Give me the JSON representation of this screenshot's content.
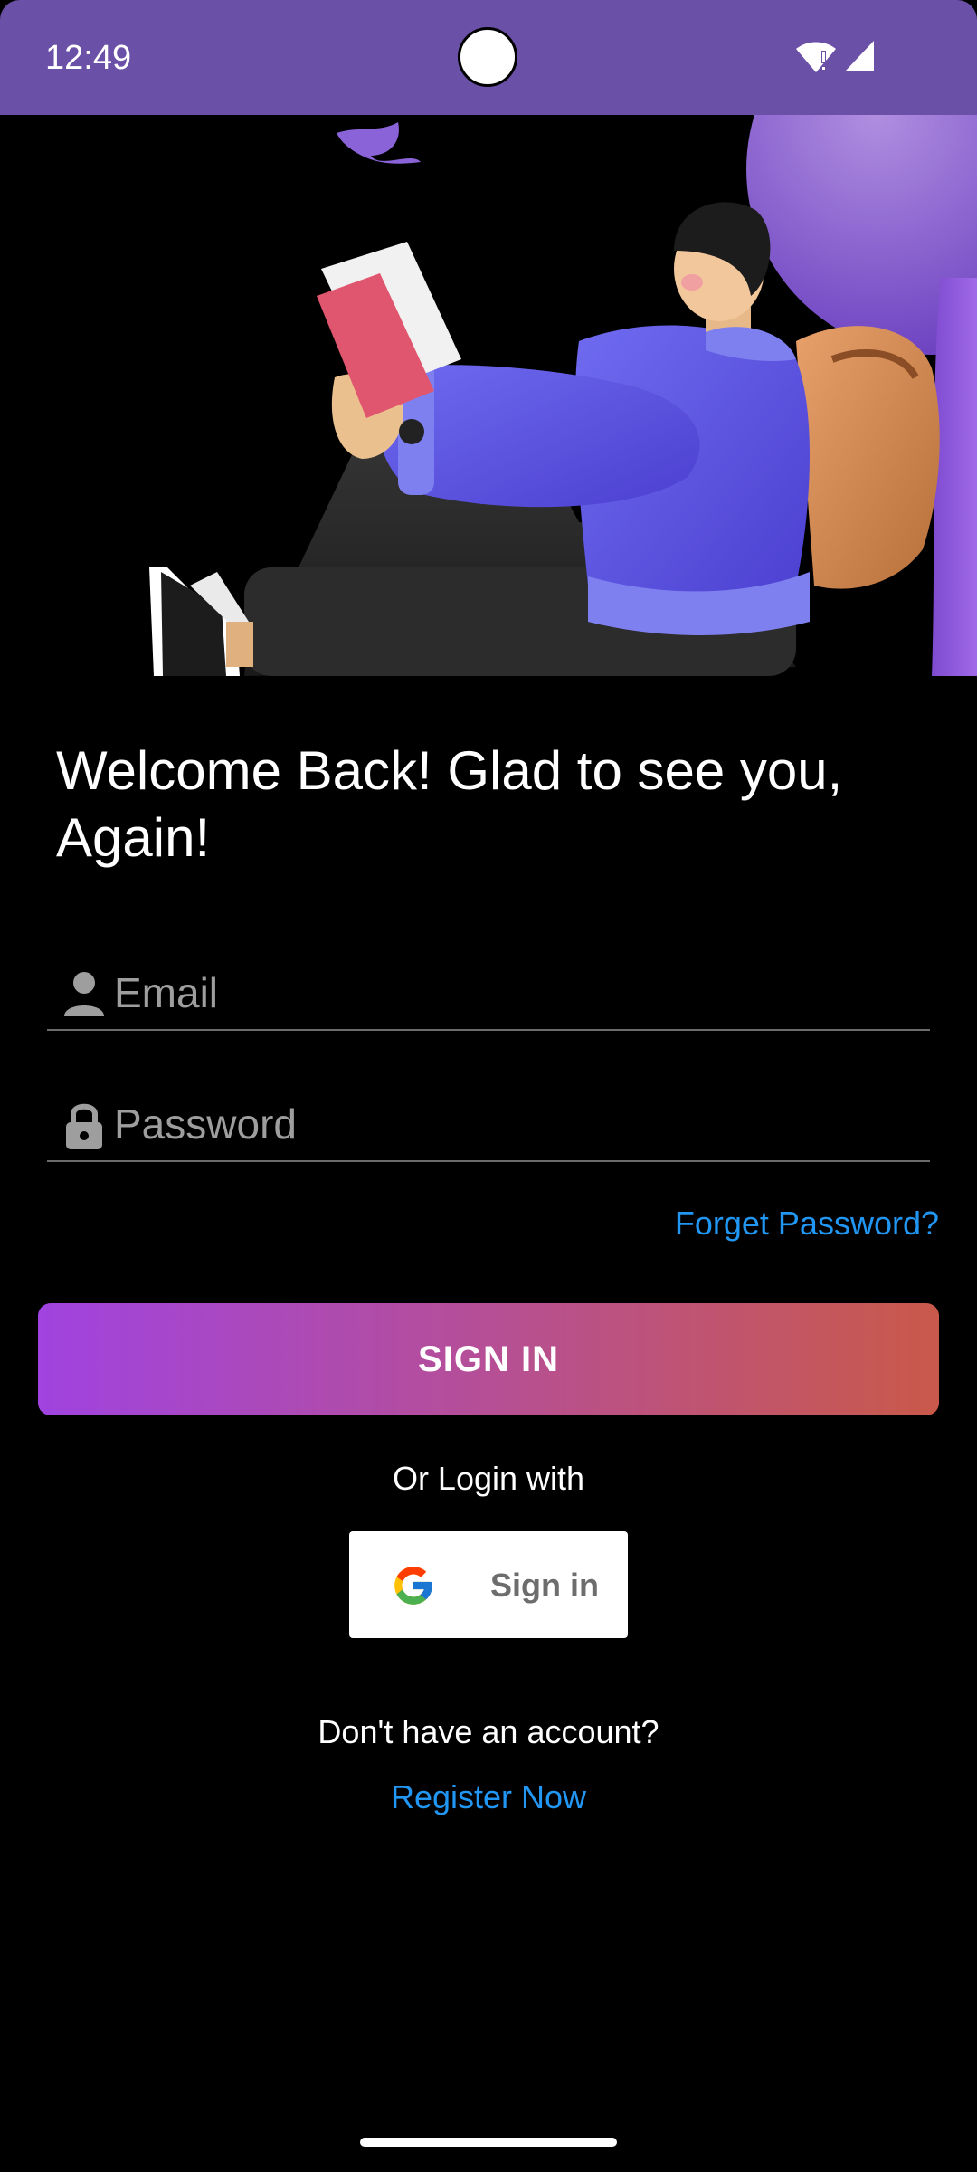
{
  "status_bar": {
    "time": "12:49",
    "wifi_icon": "wifi-alert-icon",
    "signal_icon": "cell-signal-icon",
    "background_color": "#6A50A7"
  },
  "hero": {
    "image": "person-reading-book-illustration"
  },
  "header": {
    "title": "Welcome Back! Glad to see you, Again!"
  },
  "form": {
    "email": {
      "icon": "person-icon",
      "placeholder": "Email",
      "value": ""
    },
    "password": {
      "icon": "lock-icon",
      "placeholder": "Password",
      "value": ""
    },
    "forgot_password_label": "Forget Password?",
    "sign_in_label": "SIGN IN"
  },
  "social": {
    "or_label": "Or Login with",
    "google_label": "Sign in",
    "google_icon": "google-g-icon"
  },
  "register": {
    "prompt": "Don't have an account?",
    "link_label": "Register Now"
  },
  "colors": {
    "link": "#2196F3",
    "button_gradient_start": "#A043E0",
    "button_gradient_end": "#C9594A",
    "background": "#000000"
  }
}
